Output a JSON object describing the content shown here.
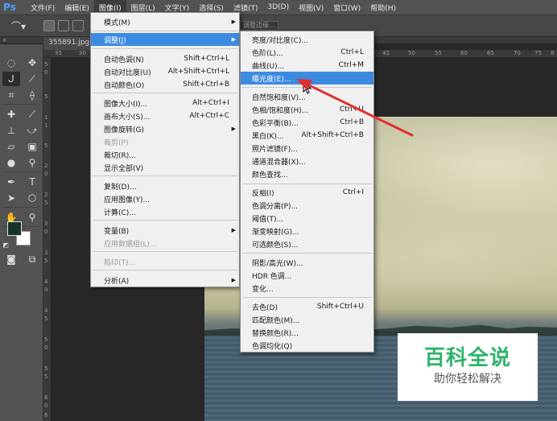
{
  "app": {
    "logo": "Ps"
  },
  "menubar": [
    {
      "label": "文件(F)"
    },
    {
      "label": "编辑(E)"
    },
    {
      "label": "图像(I)"
    },
    {
      "label": "图层(L)"
    },
    {
      "label": "文字(Y)"
    },
    {
      "label": "选择(S)"
    },
    {
      "label": "滤镜(T)"
    },
    {
      "label": "3D(D)"
    },
    {
      "label": "视图(V)"
    },
    {
      "label": "窗口(W)"
    },
    {
      "label": "帮助(H)"
    }
  ],
  "options_bar": {
    "field_text": "调整边缘..."
  },
  "document": {
    "tab_title": "355891.jpg"
  },
  "ruler": {
    "top_numbers": [
      "35",
      "30",
      "40",
      "45",
      "50",
      "55",
      "60",
      "65",
      "70",
      "75",
      "8"
    ],
    "left_numbers": [
      "5",
      "0",
      "5",
      "1",
      "1",
      "5",
      "2",
      "0",
      "2",
      "5",
      "3",
      "0",
      "3",
      "5",
      "4",
      "0",
      "4",
      "5",
      "5",
      "0",
      "5",
      "5",
      "6",
      "0",
      "6",
      "5"
    ]
  },
  "image_menu": {
    "items": [
      {
        "label": "模式(M)",
        "shortcut": "",
        "submenu": true
      },
      {
        "label": "调整(J)",
        "shortcut": "",
        "submenu": true,
        "highlighted": true
      },
      {
        "label": "自动色调(N)",
        "shortcut": "Shift+Ctrl+L"
      },
      {
        "label": "自动对比度(U)",
        "shortcut": "Alt+Shift+Ctrl+L"
      },
      {
        "label": "自动颜色(O)",
        "shortcut": "Shift+Ctrl+B"
      },
      {
        "label": "图像大小(I)...",
        "shortcut": "Alt+Ctrl+I"
      },
      {
        "label": "画布大小(S)...",
        "shortcut": "Alt+Ctrl+C"
      },
      {
        "label": "图像旋转(G)",
        "shortcut": "",
        "submenu": true
      },
      {
        "label": "裁剪(P)",
        "shortcut": "",
        "disabled": true
      },
      {
        "label": "裁切(R)...",
        "shortcut": ""
      },
      {
        "label": "显示全部(V)",
        "shortcut": ""
      },
      {
        "label": "复制(D)...",
        "shortcut": ""
      },
      {
        "label": "应用图像(Y)...",
        "shortcut": ""
      },
      {
        "label": "计算(C)...",
        "shortcut": ""
      },
      {
        "label": "变量(B)",
        "shortcut": "",
        "submenu": true
      },
      {
        "label": "应用数据组(L)...",
        "shortcut": "",
        "disabled": true
      },
      {
        "label": "陷印(T)...",
        "shortcut": "",
        "disabled": true
      },
      {
        "label": "分析(A)",
        "shortcut": "",
        "submenu": true
      }
    ]
  },
  "adjust_menu": {
    "items": [
      {
        "label": "亮度/对比度(C)...",
        "shortcut": ""
      },
      {
        "label": "色阶(L)...",
        "shortcut": "Ctrl+L"
      },
      {
        "label": "曲线(U)...",
        "shortcut": "Ctrl+M"
      },
      {
        "label": "曝光度(E)...",
        "shortcut": "",
        "highlighted": true
      },
      {
        "label": "自然饱和度(V)...",
        "shortcut": ""
      },
      {
        "label": "色相/饱和度(H)...",
        "shortcut": "Ctrl+U"
      },
      {
        "label": "色彩平衡(B)...",
        "shortcut": "Ctrl+B"
      },
      {
        "label": "黑白(K)...",
        "shortcut": "Alt+Shift+Ctrl+B"
      },
      {
        "label": "照片滤镜(F)...",
        "shortcut": ""
      },
      {
        "label": "通道混合器(X)...",
        "shortcut": ""
      },
      {
        "label": "颜色查找...",
        "shortcut": ""
      },
      {
        "label": "反相(I)",
        "shortcut": "Ctrl+I"
      },
      {
        "label": "色调分离(P)...",
        "shortcut": ""
      },
      {
        "label": "阈值(T)...",
        "shortcut": ""
      },
      {
        "label": "渐变映射(G)...",
        "shortcut": ""
      },
      {
        "label": "可选颜色(S)...",
        "shortcut": ""
      },
      {
        "label": "阴影/高光(W)...",
        "shortcut": ""
      },
      {
        "label": "HDR 色调...",
        "shortcut": ""
      },
      {
        "label": "变化...",
        "shortcut": ""
      },
      {
        "label": "去色(D)",
        "shortcut": "Shift+Ctrl+U"
      },
      {
        "label": "匹配颜色(M)...",
        "shortcut": ""
      },
      {
        "label": "替换颜色(R)...",
        "shortcut": ""
      },
      {
        "label": "色调均化(Q)",
        "shortcut": ""
      }
    ]
  },
  "colors": {
    "foreground": "#17332a",
    "background": "#ffffff",
    "highlight": "#3d8be0",
    "annotation": "#e03030"
  },
  "watermark": {
    "title": "百科全说",
    "subtitle": "助你轻松解决"
  }
}
